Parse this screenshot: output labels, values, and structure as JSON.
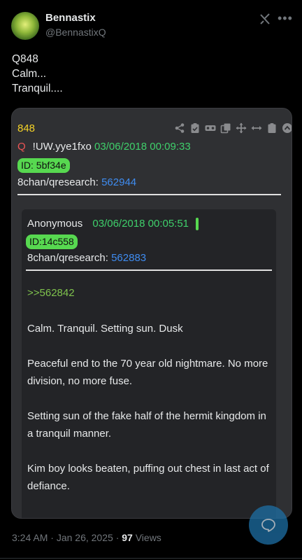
{
  "author": {
    "name": "Bennastix",
    "handle": "@BennastixQ"
  },
  "post": {
    "lines": [
      "Q848",
      "Calm...",
      "Tranquil...."
    ]
  },
  "qdrop": {
    "number": "848",
    "q_letter": "Q",
    "tripcode": "!UW.yye1fxo",
    "datetime": "03/06/2018 00:09:33",
    "id_label": "ID: 5bf34e",
    "board": "8chan/qresearch:",
    "post_ref": "562944",
    "quoted": {
      "author": "Anonymous",
      "datetime": "03/06/2018 00:05:51",
      "id_label": "ID:14c558",
      "board": "8chan/qresearch:",
      "post_ref": "562883",
      "reply_ref": ">>562842",
      "paragraphs": [
        "Calm. Tranquil. Setting sun. Dusk",
        "Peaceful end to the 70 year old nightmare. No more division, no more fuse.",
        "Setting sun of the fake half of the hermit kingdom in a tranquil manner.",
        "Kim boy looks beaten, puffing out chest in last act of defiance."
      ]
    },
    "toolbar_icons": [
      "share-icon",
      "clipboard-check-icon",
      "vr-headset-icon",
      "copy-icon",
      "move-icon",
      "resize-icon",
      "clipboard-icon",
      "chevron-up-circle-icon"
    ]
  },
  "footer": {
    "time": "3:24 AM",
    "separator1": "·",
    "date": "Jan 26, 2025",
    "separator2": "·",
    "views_count": "97",
    "views_label": "Views"
  },
  "colors": {
    "background": "#000000",
    "qnum": "#f5d327",
    "green": "#3fd06b",
    "link_blue": "#3f8cf0",
    "quote_green": "#7fc24d",
    "fab": "#1d6fa5"
  }
}
